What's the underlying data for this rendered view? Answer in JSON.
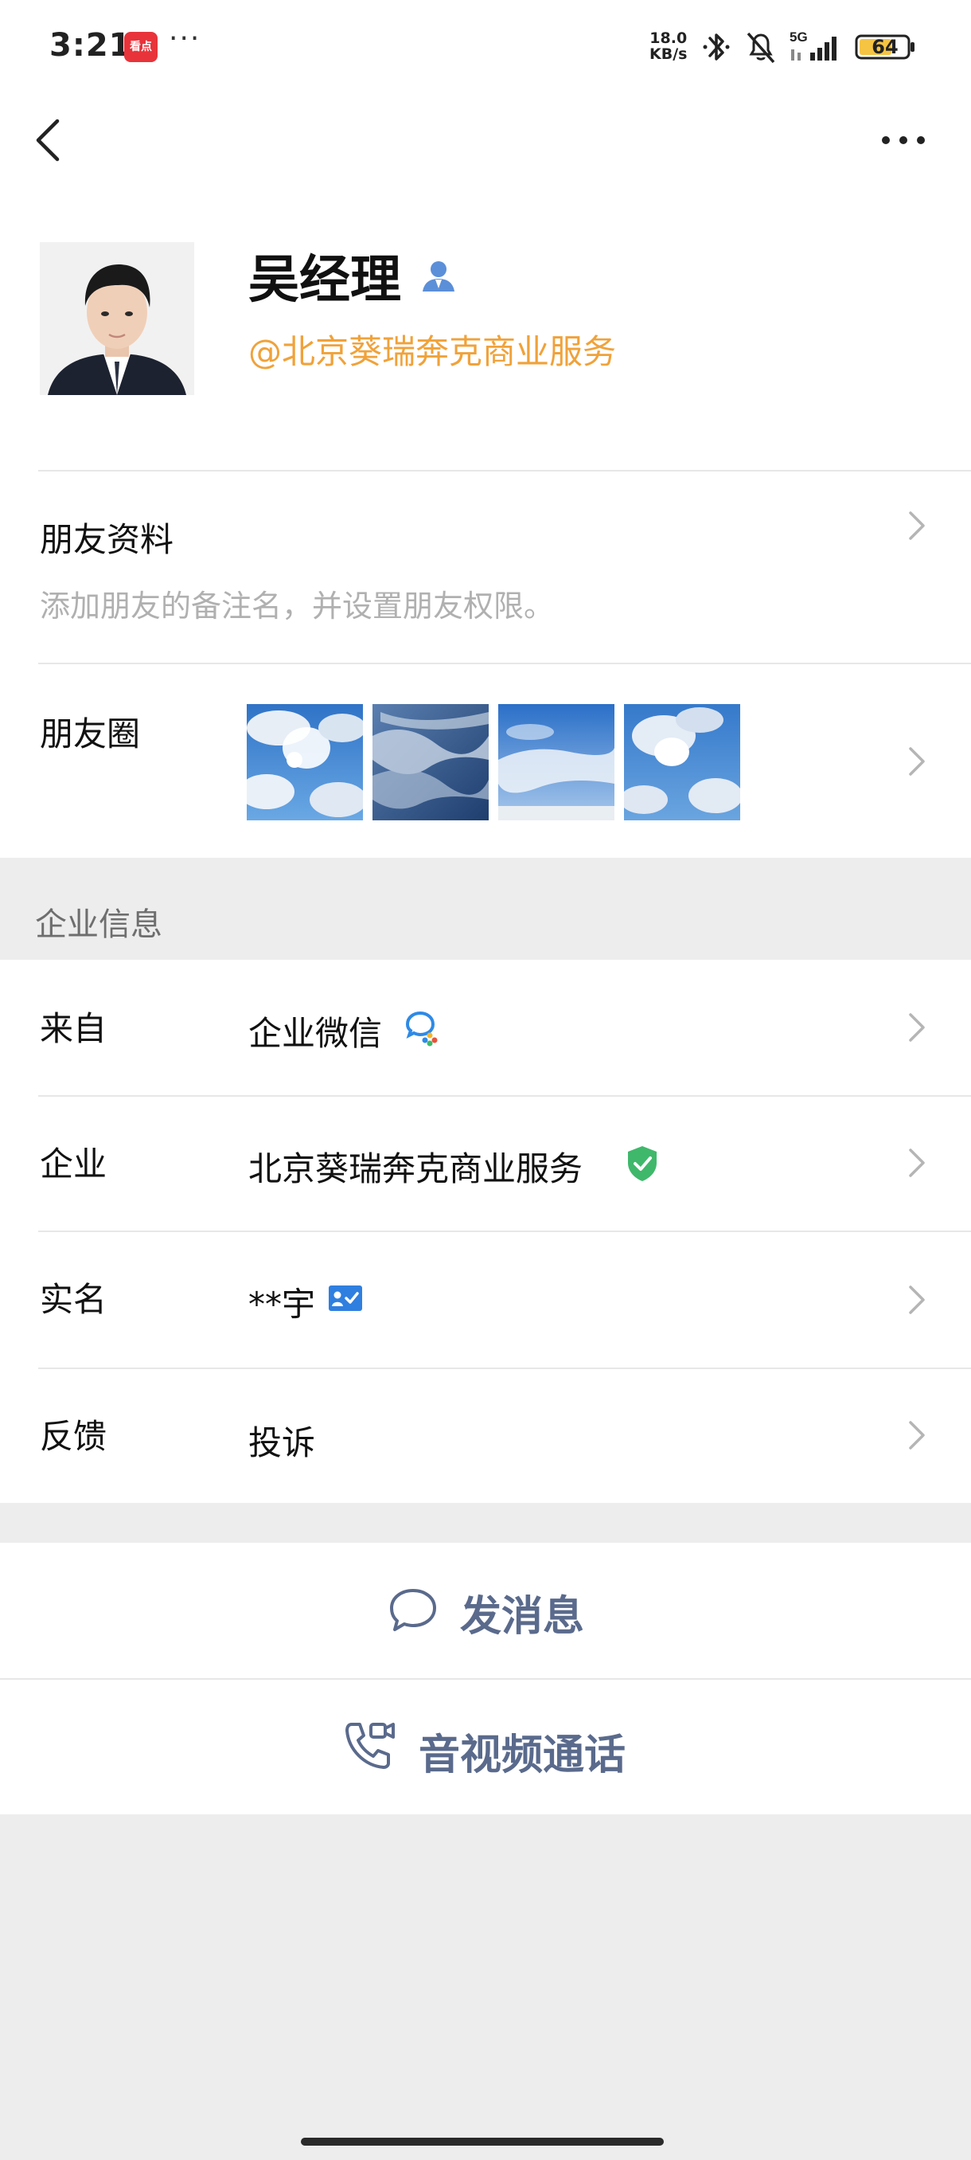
{
  "status_bar": {
    "time": "3:21",
    "app_icon_text": "看点",
    "more_dots": "···",
    "net_speed_top": "18.0",
    "net_speed_bottom": "KB/s",
    "network": "5G",
    "battery": "64"
  },
  "nav": {
    "back_icon": "chevron-left-icon",
    "more_icon": "more-horizontal-icon"
  },
  "profile": {
    "name": "吴经理",
    "company_tag": "@北京葵瑞奔克商业服务"
  },
  "friend_info": {
    "title": "朋友资料",
    "subtitle": "添加朋友的备注名，并设置朋友权限。"
  },
  "moments": {
    "title": "朋友圈"
  },
  "enterprise_section": {
    "header": "企业信息",
    "rows": [
      {
        "label": "来自",
        "value": "企业微信"
      },
      {
        "label": "企业",
        "value": "北京葵瑞奔克商业服务"
      },
      {
        "label": "实名",
        "value": "**宇"
      },
      {
        "label": "反馈",
        "value": "投诉"
      }
    ]
  },
  "actions": {
    "message": "发消息",
    "call": "音视频通话"
  },
  "colors": {
    "accent_orange": "#f0a23a",
    "action_blue": "#5a6a8c",
    "verified_green": "#3fb86b",
    "background": "#ededed"
  }
}
